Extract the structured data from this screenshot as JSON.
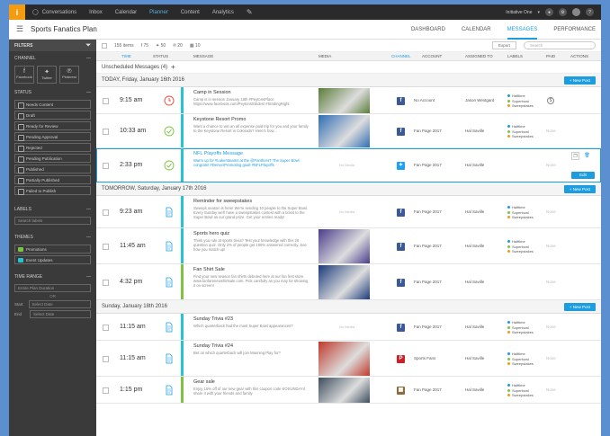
{
  "topnav": {
    "logo": "i",
    "items": [
      "Conversations",
      "Inbox",
      "Calendar",
      "Planner",
      "Content",
      "Analytics"
    ],
    "active": "Planner",
    "user": "Initiative One"
  },
  "header": {
    "title": "Sports Fanatics Plan",
    "tabs": [
      "DASHBOARD",
      "CALENDAR",
      "MESSAGES",
      "PERFORMANCE"
    ],
    "active_tab": "MESSAGES"
  },
  "sidebar": {
    "filters_label": "FILTERS",
    "channel_label": "CHANNEL",
    "channels": [
      "Facebook",
      "Twitter",
      "Pinterest"
    ],
    "status_label": "STATUS",
    "statuses": [
      "Needs Content",
      "Draft",
      "Ready for Review",
      "Pending Approval",
      "Rejected",
      "Pending Publication",
      "Published",
      "Partially Published",
      "Failed to Publish"
    ],
    "labels_label": "LABELS",
    "labels_placeholder": "Search labels",
    "themes_label": "THEMES",
    "themes": [
      "Promotions",
      "Event Updates"
    ],
    "range_label": "TIME RANGE",
    "range_value": "Entire Plan Duration",
    "or_label": "OR",
    "start_label": "Start",
    "end_label": "End",
    "date_placeholder": "Select Date"
  },
  "toolbar": {
    "items_count": "155 items",
    "fb_count": "75",
    "tw_count": "50",
    "pin_count": "20",
    "other_count": "10",
    "export_label": "Export",
    "search_placeholder": "Search"
  },
  "columns": [
    "TIME",
    "STATUS",
    "MESSAGE",
    "MEDIA",
    "CHANNEL",
    "ACCOUNT",
    "ASSIGNED TO",
    "LABELS",
    "PAID",
    "ACTIONS"
  ],
  "unscheduled": "Unscheduled Messages (4)",
  "new_post_label": "New Post",
  "no_media": "No Media",
  "days": [
    {
      "label": "TODAY, Friday, January 16th 2016",
      "rows": [
        {
          "time": "9:15 am",
          "status": "clock",
          "title": "Camp in Session",
          "body": "Camp is in session January 16th #PeytonsPlace https://www.facebook.com/PeytonsStrides/ #StridingRight",
          "channel": "fb",
          "account": "No Account",
          "assignee": "Jason Westgard",
          "labels": [
            "Halftime",
            "Superbowl",
            "Sweepstakes"
          ],
          "paid": "dollar"
        },
        {
          "time": "10:33 am",
          "status": "check",
          "title": "Keystone Resort Promo",
          "body": "Want a chance to win an all expense paid trip for you and your family to the Keystone Resort in Colorado? Here's how...",
          "channel": "fb",
          "account": "Fan Page 2017",
          "assignee": "Hal Saville",
          "labels": [
            "Halftime",
            "Superbowl",
            "Sweepstakes"
          ],
          "paid": "None"
        },
        {
          "time": "2:33 pm",
          "status": "check",
          "title": "NFL Playoffs Message",
          "body": "Warm up for #Lakersteams at the @PanthersT The Super Bowl congrats! #DenverPromoting goal! #NFLPlayoffs",
          "channel": "tw",
          "account": "Fan Page 2017",
          "assignee": "Hal Saville",
          "labels": [],
          "paid": "None",
          "selected": true,
          "edit_label": "Edit"
        }
      ]
    },
    {
      "label": "TOMORROW, Saturday, January 17th 2016",
      "rows": [
        {
          "time": "9:23 am",
          "status": "doc",
          "title": "Reminder for sweepstakes",
          "body": "Sweeps season is here! We're sending 10 people to the Super Bowl. Every Sunday we'll have a sweepstakes contest with a ticket to the Super Bowl as our grand prize. Get your entries ready!",
          "channel": "fb",
          "account": "Fan Page 2017",
          "assignee": "Hal Saville",
          "labels": [
            "Halftime",
            "Superbowl",
            "Sweepstakes"
          ],
          "paid": "None"
        },
        {
          "time": "11:45 am",
          "status": "doc",
          "title": "Sports hero quiz",
          "body": "Think you rule at sports trivia? Test your knowledge with this 20 question quiz. Only 2% of people get 100% answered correctly. See how you match up!",
          "channel": "fb",
          "account": "Fan Page 2017",
          "assignee": "Hal Saville",
          "labels": [
            "Halftime",
            "Superbowl",
            "Sweepstakes"
          ],
          "paid": "None"
        },
        {
          "time": "4:32 pm",
          "status": "doc",
          "title": "Fan Shirt Sale",
          "body": "Find your new season fan shirts debuted here at our fan fest store. www.fanfarenewshirtsale.com. Pick carefully as you may be showing it on screen!",
          "channel": "fb",
          "account": "Fan Page 2017",
          "assignee": "Hal Saville",
          "labels": [],
          "paid": "None"
        }
      ]
    },
    {
      "label": "Sunday, January 18th 2016",
      "rows": [
        {
          "time": "11:15 am",
          "status": "doc",
          "title": "Sunday Trivia #23",
          "body": "Which quarterback had the most Super Bowl appearances?",
          "channel": "fb",
          "account": "Fan Page 2017",
          "assignee": "Hal Saville",
          "labels": [
            "Halftime",
            "Superbowl",
            "Sweepstakes"
          ],
          "paid": "None"
        },
        {
          "time": "11:15 am",
          "status": "doc",
          "title": "Sunday Trivia #24",
          "body": "Bet on which quarterback will join Manning Play for?",
          "channel": "pin",
          "account": "Sports Fans",
          "assignee": "Hal Saville",
          "labels": [
            "Halftime",
            "Superbowl",
            "Sweepstakes"
          ],
          "paid": "None"
        },
        {
          "time": "1:15 pm",
          "status": "doc",
          "title": "Gear sale",
          "body": "Enjoy 15% off of our new gear with this coupon code KOSUNDAY4 share it with your friends and family",
          "channel": "other",
          "account": "Fan Page 2017",
          "assignee": "Hal Saville",
          "labels": [
            "Halftime",
            "Superbowl",
            "Sweepstakes"
          ],
          "paid": "None"
        }
      ]
    }
  ],
  "colors": {
    "accent": "#1b9de0",
    "teal": "#27c3d0",
    "green": "#7dc242",
    "red": "#e74c3c",
    "fb": "#3b5998",
    "tw": "#1da1f2",
    "pin": "#cb2027"
  }
}
